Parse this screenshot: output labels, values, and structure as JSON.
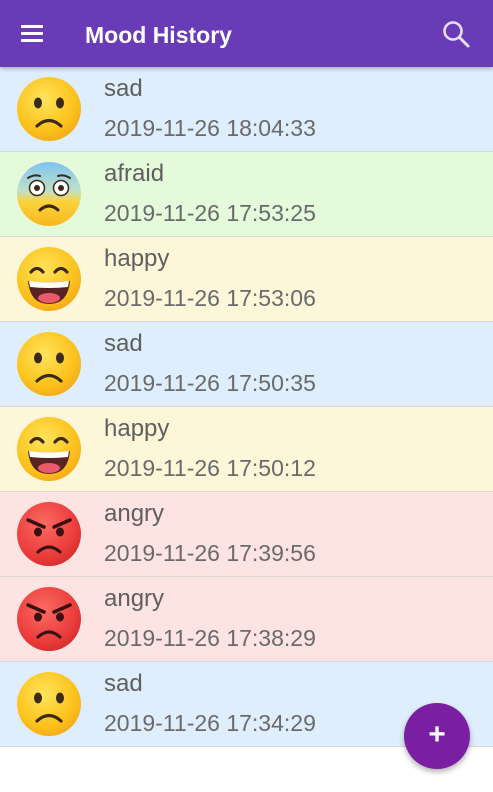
{
  "appbar": {
    "title": "Mood History",
    "menu_icon": "menu-icon",
    "search_icon": "search-icon",
    "color": "#6a3bb7"
  },
  "moods": [
    {
      "mood": "sad",
      "time": "2019-11-26 18:04:33",
      "icon": "sad-face-icon",
      "bg": "#deeefc"
    },
    {
      "mood": "afraid",
      "time": "2019-11-26 17:53:25",
      "icon": "fearful-face-icon",
      "bg": "#e4fadb"
    },
    {
      "mood": "happy",
      "time": "2019-11-26 17:53:06",
      "icon": "grinning-face-icon",
      "bg": "#fef6d9"
    },
    {
      "mood": "sad",
      "time": "2019-11-26 17:50:35",
      "icon": "sad-face-icon",
      "bg": "#deeefc"
    },
    {
      "mood": "happy",
      "time": "2019-11-26 17:50:12",
      "icon": "grinning-face-icon",
      "bg": "#fef6d9"
    },
    {
      "mood": "angry",
      "time": "2019-11-26 17:39:56",
      "icon": "angry-face-icon",
      "bg": "#fde3e1"
    },
    {
      "mood": "angry",
      "time": "2019-11-26 17:38:29",
      "icon": "angry-face-icon",
      "bg": "#fde3e1"
    },
    {
      "mood": "sad",
      "time": "2019-11-26 17:34:29",
      "icon": "sad-face-icon",
      "bg": "#deeefc"
    }
  ],
  "fab": {
    "label": "+",
    "icon": "plus-icon",
    "color": "#7b1fa2"
  }
}
